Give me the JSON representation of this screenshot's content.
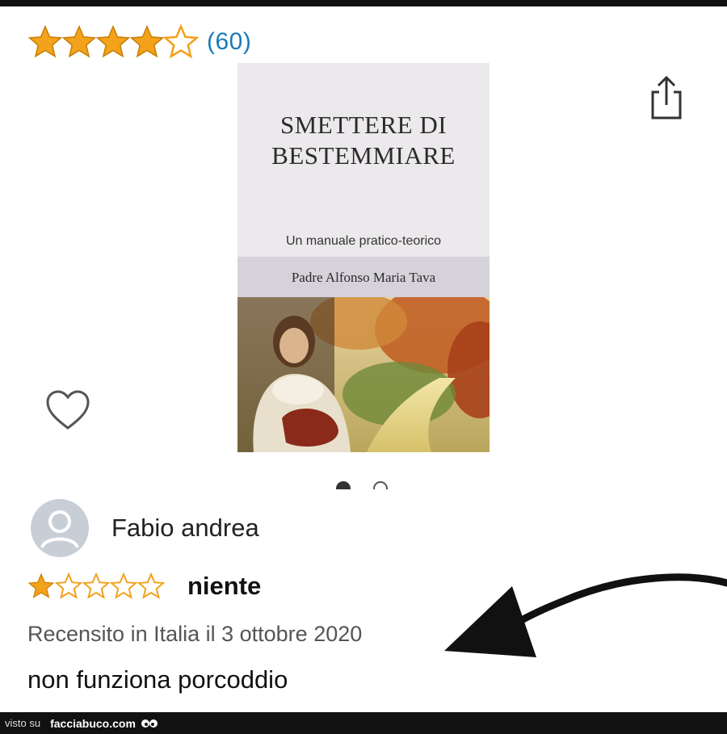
{
  "product": {
    "rating_count": "(60)",
    "rating_value": 4,
    "rating_max": 5,
    "star_color": "#f2a21b"
  },
  "book": {
    "title_line1": "SMETTERE DI",
    "title_line2": "BESTEMMIARE",
    "subtitle": "Un manuale pratico-teorico",
    "author": "Padre Alfonso Maria Tava"
  },
  "carousel": {
    "current": 1,
    "total": 2
  },
  "review": {
    "reviewer_name": "Fabio andrea",
    "rating_value": 1,
    "rating_max": 5,
    "title": "niente",
    "meta": "Recensito in Italia il 3 ottobre 2020",
    "body": "non funziona porcoddio"
  },
  "footer": {
    "visto_su": "visto su",
    "site": "facciabuco.com"
  },
  "colors": {
    "link": "#1a7bb9",
    "star": "#f2a21b",
    "footer_bg": "#111111"
  }
}
